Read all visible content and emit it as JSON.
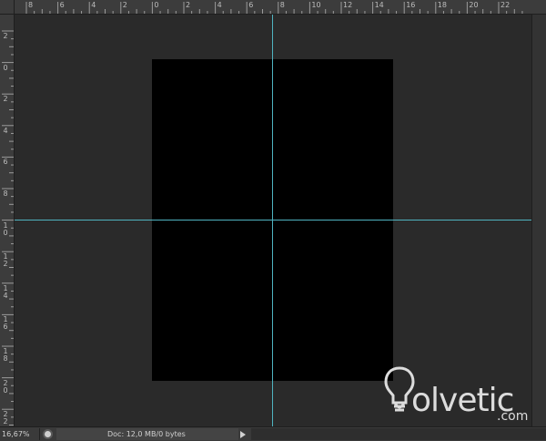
{
  "ruler_top": {
    "labels": [
      "8",
      "6",
      "4",
      "2",
      "0",
      "2",
      "4",
      "6",
      "8",
      "10",
      "12",
      "14",
      "16",
      "18",
      "20",
      "22"
    ]
  },
  "ruler_left": {
    "labels": [
      "2",
      "0",
      "2",
      "4",
      "6",
      "8",
      "1 0",
      "1 2",
      "1 4",
      "1 6",
      "1 8",
      "2 0",
      "2 2"
    ]
  },
  "canvas": {
    "document_color": "#000000",
    "background_color": "#2a2a2a",
    "guide_color": "#4fb3c0"
  },
  "statusbar": {
    "zoom": "16,67%",
    "doc_info": "Doc: 12,0 MB/0 bytes",
    "arrow_icon": "triangle-right-icon",
    "info_icon": "circle-icon"
  },
  "watermark": {
    "brand": "olvetic",
    "domain": ".com",
    "logo_icon": "lightbulb-icon"
  }
}
